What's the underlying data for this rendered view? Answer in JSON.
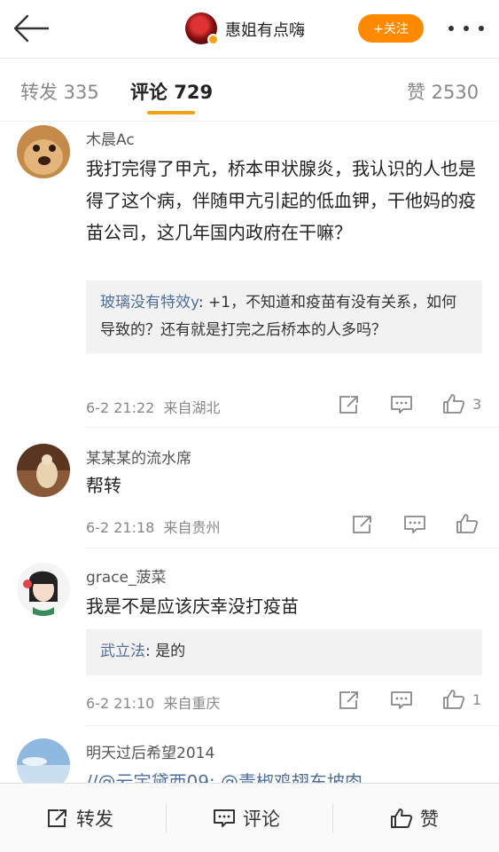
{
  "header": {
    "user_name": "惠姐有点嗨",
    "follow_label": "+关注"
  },
  "tabs": {
    "repost": "转发 335",
    "comment": "评论 729",
    "like": "赞 2530"
  },
  "comments": [
    {
      "name": "木晨Ac",
      "text": "我打完得了甲亢，桥本甲状腺炎，我认识的人也是得了这个病，伴随甲亢引起的低血钾，干他妈的疫苗公司，这几年国内政府在干嘛？",
      "reply_name": "玻璃没有特效y",
      "reply_text": ": +1，不知道和疫苗有没有关系，如何导致的？还有就是打完之后桥本的人多吗？",
      "time": "6-2 21:22",
      "location": "来自湖北",
      "likes": "3"
    },
    {
      "name": "某某某的流水席",
      "text": "帮转",
      "time": "6-2 21:18",
      "location": "来自贵州",
      "likes": ""
    },
    {
      "name": "grace_菠菜",
      "text": "我是不是应该庆幸没打疫苗",
      "reply_name": "武立法",
      "reply_text": ": 是的",
      "time": "6-2 21:10",
      "location": "来自重庆",
      "likes": "1"
    },
    {
      "name": "明天过后希望2014",
      "text": "//@云宇黛西09: @青椒鸡翅东坡肉"
    }
  ],
  "bottom": {
    "repost": "转发",
    "comment": "评论",
    "like": "赞"
  },
  "colors": {
    "accent": "#ff8a00",
    "tab_underline": "#f2a30f",
    "reply_name": "#4f6f9b"
  }
}
